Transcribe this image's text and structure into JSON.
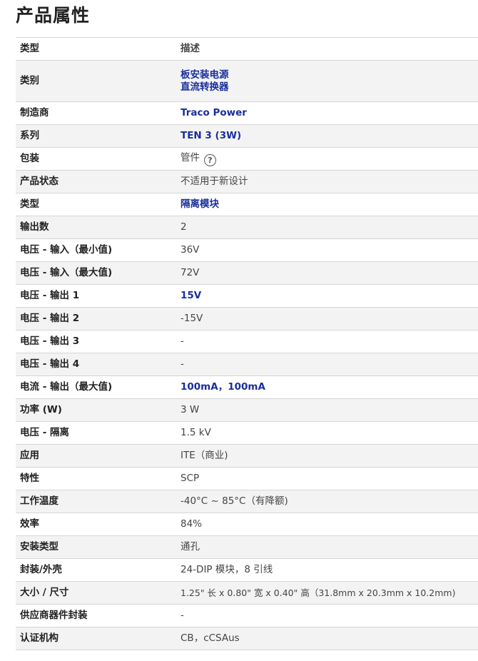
{
  "title": "产品属性",
  "header": {
    "type_label": "类型",
    "desc_label": "描述"
  },
  "rows": {
    "category": {
      "label": "类别",
      "value_line1": "板安装电源",
      "value_line2": "直流转换器"
    },
    "manufacturer": {
      "label": "制造商",
      "value": "Traco Power"
    },
    "series": {
      "label": "系列",
      "value": "TEN 3 (3W)"
    },
    "packaging": {
      "label": "包装",
      "value": "管件",
      "help_icon": "question-circle-icon"
    },
    "product_status": {
      "label": "产品状态",
      "value": "不适用于新设计"
    },
    "type": {
      "label": "类型",
      "value": "隔离模块"
    },
    "outputs": {
      "label": "输出数",
      "value": "2"
    },
    "vin_min": {
      "label": "电压 - 输入（最小值)",
      "value": "36V"
    },
    "vin_max": {
      "label": "电压 - 输入（最大值)",
      "value": "72V"
    },
    "vout1": {
      "label": "电压 - 输出 1",
      "value": "15V"
    },
    "vout2": {
      "label": "电压 - 输出 2",
      "value": "-15V"
    },
    "vout3": {
      "label": "电压 - 输出 3",
      "value": "-"
    },
    "vout4": {
      "label": "电压 - 输出 4",
      "value": "-"
    },
    "iout_max": {
      "label": "电流 - 输出（最大值)",
      "value": "100mA，100mA"
    },
    "power": {
      "label": "功率 (W)",
      "value": "3 W"
    },
    "isolation": {
      "label": "电压 - 隔离",
      "value": "1.5 kV"
    },
    "application": {
      "label": "应用",
      "value": "ITE（商业)"
    },
    "features": {
      "label": "特性",
      "value": "SCP"
    },
    "temp": {
      "label": "工作温度",
      "value": "-40°C ~ 85°C（有降额)"
    },
    "efficiency": {
      "label": "效率",
      "value": "84%"
    },
    "mounting": {
      "label": "安装类型",
      "value": "通孔"
    },
    "package": {
      "label": "封装/外壳",
      "value": "24-DIP 模块，8 引线"
    },
    "size": {
      "label": "大小 / 尺寸",
      "value": "1.25\" 长 x 0.80\" 宽 x 0.40\" 高（31.8mm x 20.3mm x 10.2mm)"
    },
    "supplier_pkg": {
      "label": "供应商器件封装",
      "value": "-"
    },
    "approvals": {
      "label": "认证机构",
      "value": "CB，cCSAus"
    }
  },
  "colors": {
    "link": "#1a2f9b",
    "shaded_row": "#f3f3f3",
    "border": "#d6d6d6"
  }
}
